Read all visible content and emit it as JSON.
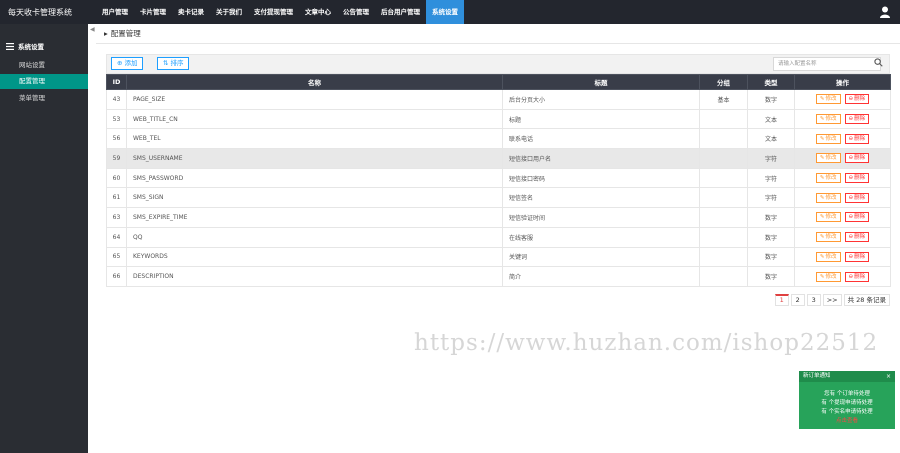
{
  "app": {
    "title": "每天收卡管理系统"
  },
  "nav": {
    "items": [
      "用户管理",
      "卡片管理",
      "卖卡记录",
      "关于我们",
      "支付提现管理",
      "文章中心",
      "公告管理",
      "后台用户管理",
      "系统设置"
    ],
    "active_index": 8
  },
  "sidebar": {
    "group": "系统设置",
    "items": [
      "网站设置",
      "配置管理",
      "菜单管理"
    ],
    "active_index": 1
  },
  "breadcrumb": {
    "title": "配置管理"
  },
  "toolbar": {
    "add_label": "添加",
    "sort_label": "排序",
    "search_placeholder": "请输入配置名称"
  },
  "table": {
    "headers": [
      "ID",
      "名称",
      "标题",
      "分组",
      "类型",
      "操作"
    ],
    "rows": [
      {
        "id": "43",
        "name": "PAGE_SIZE",
        "title": "后台分页大小",
        "group": "基本",
        "type": "数字"
      },
      {
        "id": "53",
        "name": "WEB_TITLE_CN",
        "title": "标题",
        "group": "",
        "type": "文本"
      },
      {
        "id": "56",
        "name": "WEB_TEL",
        "title": "联系电话",
        "group": "",
        "type": "文本"
      },
      {
        "id": "59",
        "name": "SMS_USERNAME",
        "title": "短信接口用户名",
        "group": "",
        "type": "字符"
      },
      {
        "id": "60",
        "name": "SMS_PASSWORD",
        "title": "短信接口密码",
        "group": "",
        "type": "字符"
      },
      {
        "id": "61",
        "name": "SMS_SIGN",
        "title": "短信签名",
        "group": "",
        "type": "字符"
      },
      {
        "id": "63",
        "name": "SMS_EXPIRE_TIME",
        "title": "短信验证时间",
        "group": "",
        "type": "数字"
      },
      {
        "id": "64",
        "name": "QQ",
        "title": "在线客服",
        "group": "",
        "type": "数字"
      },
      {
        "id": "65",
        "name": "KEYWORDS",
        "title": "关键词",
        "group": "",
        "type": "数字"
      },
      {
        "id": "66",
        "name": "DESCRIPTION",
        "title": "简介",
        "group": "",
        "type": "数字"
      }
    ],
    "highlight_row": 3,
    "edit_label": "修改",
    "delete_label": "删除"
  },
  "pagination": {
    "pages": [
      "1",
      "2",
      "3"
    ],
    "current": "1",
    "next": ">>",
    "total": "共 28 条记录"
  },
  "watermark": "https://www.huzhan.com/ishop22512",
  "notice": {
    "title": "新订单通知",
    "close": "×",
    "lines": [
      "您有 个订单待处理",
      "有 个提现申请待处理",
      "有 个实名申请待处理"
    ],
    "link": "点击查看"
  },
  "colors": {
    "topbar": "#23262e",
    "sidebar": "#2a2d33",
    "active_nav": "#2f8fdc",
    "active_side": "#009688",
    "table_head": "#393d49",
    "edit": "#ff9933",
    "delete": "#ff3333",
    "notice": "#27a35a"
  }
}
